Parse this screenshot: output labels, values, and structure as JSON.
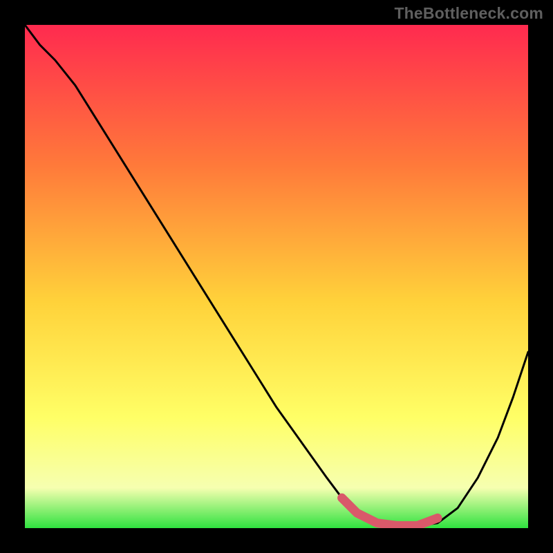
{
  "watermark": "TheBottleneck.com",
  "colors": {
    "background": "#000000",
    "gradient_top": "#ff2a4f",
    "gradient_mid_upper": "#ff7a3a",
    "gradient_mid": "#ffd23a",
    "gradient_mid_lower": "#ffff66",
    "gradient_lower": "#f6ffb0",
    "gradient_bottom": "#2fe23f",
    "curve": "#000000",
    "marker": "#d9596a"
  },
  "chart_data": {
    "type": "line",
    "title": "",
    "xlabel": "",
    "ylabel": "",
    "xlim": [
      0,
      100
    ],
    "ylim": [
      0,
      100
    ],
    "grid": false,
    "legend": false,
    "series": [
      {
        "name": "bottleneck-curve",
        "x": [
          0,
          3,
          6,
          10,
          15,
          20,
          25,
          30,
          35,
          40,
          45,
          50,
          55,
          60,
          63,
          66,
          70,
          74,
          78,
          82,
          86,
          90,
          94,
          97,
          100
        ],
        "y": [
          100,
          96,
          93,
          88,
          80,
          72,
          64,
          56,
          48,
          40,
          32,
          24,
          17,
          10,
          6,
          3,
          1,
          0.5,
          0.5,
          1,
          4,
          10,
          18,
          26,
          35
        ]
      }
    ],
    "highlight_segment": {
      "name": "optimal-range",
      "x": [
        63,
        66,
        70,
        74,
        78,
        82
      ],
      "y": [
        6,
        3,
        1,
        0.5,
        0.5,
        2
      ]
    }
  }
}
